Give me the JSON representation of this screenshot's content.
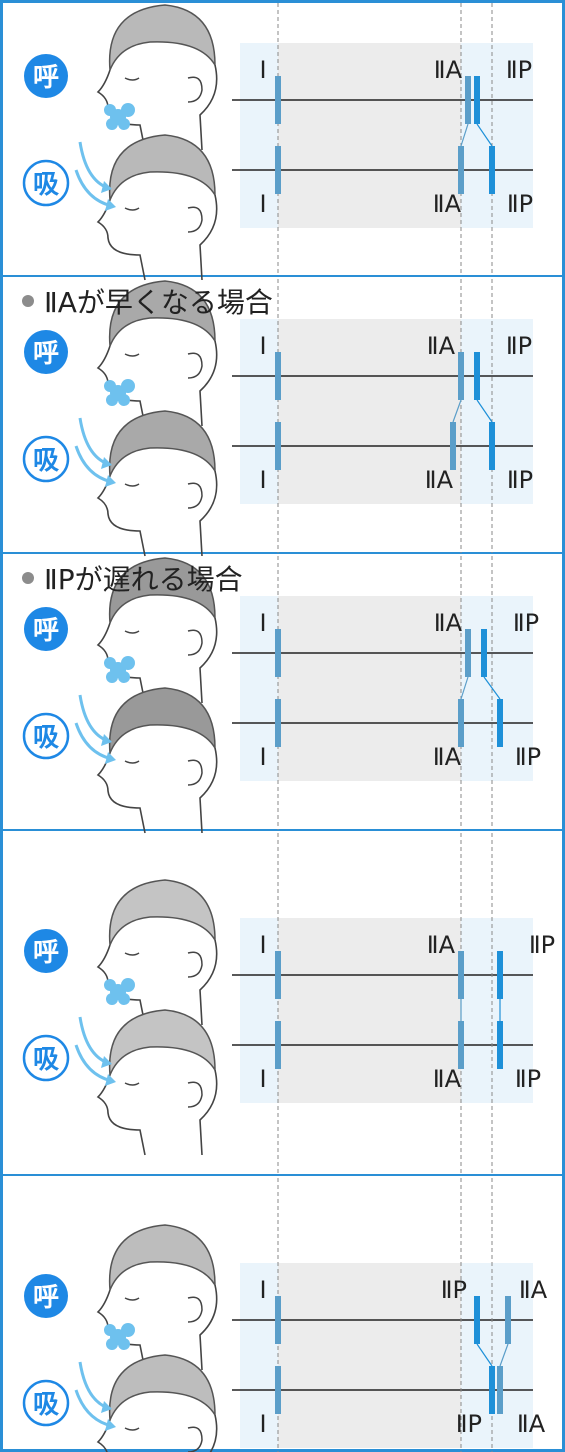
{
  "colors": {
    "border": "#2a8fd6",
    "shaded_band": "#eaf4fb",
    "grey_band": "#ececec",
    "a2_bar": "#5b9ec9",
    "p2_bar": "#1e90d8",
    "badge_fill": "#1e88e5",
    "breath_arrow": "#6ec1ee"
  },
  "labels": {
    "expiration": "呼",
    "inspiration": "吸",
    "s1": "Ⅰ",
    "a2": "ⅡA",
    "p2": "ⅡP"
  },
  "panels": [
    {
      "title": "",
      "hair": "#b9b9b9",
      "a2_exp": 468,
      "p2_exp": 477,
      "a2_insp": 461,
      "p2_insp": 492,
      "label_order": "normal"
    },
    {
      "title": "ⅡAが早くなる場合",
      "hair": "#a9a9a9",
      "a2_exp": 461,
      "p2_exp": 477,
      "a2_insp": 453,
      "p2_insp": 492,
      "label_order": "normal"
    },
    {
      "title": "ⅡPが遅れる場合",
      "hair": "#999999",
      "a2_exp": 468,
      "p2_exp": 484,
      "a2_insp": 461,
      "p2_insp": 500,
      "label_order": "normal"
    },
    {
      "title": "",
      "hair": "#c4c4c4",
      "a2_exp": 461,
      "p2_exp": 500,
      "a2_insp": 461,
      "p2_insp": 500,
      "label_order": "normal"
    },
    {
      "title": "",
      "hair": "#bdbdbd",
      "a2_exp": 508,
      "p2_exp": 477,
      "a2_insp": 500,
      "p2_insp": 492,
      "label_order": "reversed"
    }
  ]
}
